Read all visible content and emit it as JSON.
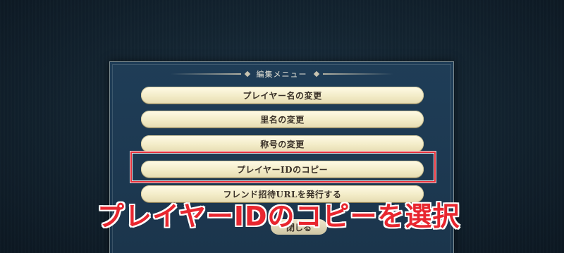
{
  "menu": {
    "title": "編集メニュー",
    "items": [
      {
        "label": "プレイヤー名の変更"
      },
      {
        "label": "里名の変更"
      },
      {
        "label": "称号の変更"
      },
      {
        "label": "プレイヤーIDのコピー",
        "highlighted": true
      },
      {
        "label": "フレンド招待URLを発行する"
      }
    ],
    "close_label": "閉じる"
  },
  "annotation": {
    "caption": "プレイヤーIDのコピーを選択",
    "highlight_color": "#e8313b"
  },
  "colors": {
    "panel": "#1f3d57",
    "button": "#f3ecc8",
    "button_text": "#3a3128",
    "caption": "#e8262f"
  }
}
